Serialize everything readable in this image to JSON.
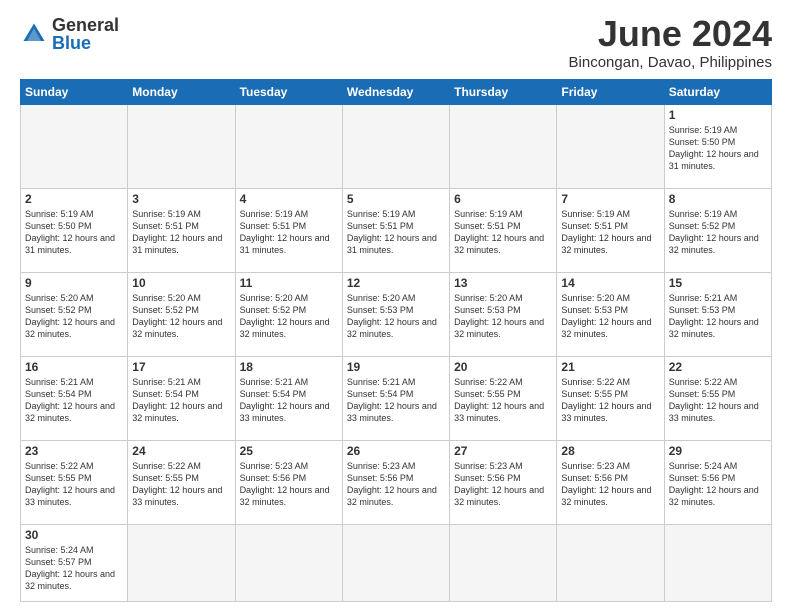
{
  "logo": {
    "general": "General",
    "blue": "Blue"
  },
  "header": {
    "title": "June 2024",
    "subtitle": "Bincongan, Davao, Philippines"
  },
  "days_of_week": [
    "Sunday",
    "Monday",
    "Tuesday",
    "Wednesday",
    "Thursday",
    "Friday",
    "Saturday"
  ],
  "weeks": [
    [
      {
        "day": "",
        "info": "",
        "empty": true
      },
      {
        "day": "",
        "info": "",
        "empty": true
      },
      {
        "day": "",
        "info": "",
        "empty": true
      },
      {
        "day": "",
        "info": "",
        "empty": true
      },
      {
        "day": "",
        "info": "",
        "empty": true
      },
      {
        "day": "",
        "info": "",
        "empty": true
      },
      {
        "day": "1",
        "info": "Sunrise: 5:19 AM\nSunset: 5:50 PM\nDaylight: 12 hours\nand 31 minutes."
      }
    ],
    [
      {
        "day": "2",
        "info": "Sunrise: 5:19 AM\nSunset: 5:50 PM\nDaylight: 12 hours\nand 31 minutes."
      },
      {
        "day": "3",
        "info": "Sunrise: 5:19 AM\nSunset: 5:51 PM\nDaylight: 12 hours\nand 31 minutes."
      },
      {
        "day": "4",
        "info": "Sunrise: 5:19 AM\nSunset: 5:51 PM\nDaylight: 12 hours\nand 31 minutes."
      },
      {
        "day": "5",
        "info": "Sunrise: 5:19 AM\nSunset: 5:51 PM\nDaylight: 12 hours\nand 31 minutes."
      },
      {
        "day": "6",
        "info": "Sunrise: 5:19 AM\nSunset: 5:51 PM\nDaylight: 12 hours\nand 32 minutes."
      },
      {
        "day": "7",
        "info": "Sunrise: 5:19 AM\nSunset: 5:51 PM\nDaylight: 12 hours\nand 32 minutes."
      },
      {
        "day": "8",
        "info": "Sunrise: 5:19 AM\nSunset: 5:52 PM\nDaylight: 12 hours\nand 32 minutes."
      }
    ],
    [
      {
        "day": "9",
        "info": "Sunrise: 5:20 AM\nSunset: 5:52 PM\nDaylight: 12 hours\nand 32 minutes."
      },
      {
        "day": "10",
        "info": "Sunrise: 5:20 AM\nSunset: 5:52 PM\nDaylight: 12 hours\nand 32 minutes."
      },
      {
        "day": "11",
        "info": "Sunrise: 5:20 AM\nSunset: 5:52 PM\nDaylight: 12 hours\nand 32 minutes."
      },
      {
        "day": "12",
        "info": "Sunrise: 5:20 AM\nSunset: 5:53 PM\nDaylight: 12 hours\nand 32 minutes."
      },
      {
        "day": "13",
        "info": "Sunrise: 5:20 AM\nSunset: 5:53 PM\nDaylight: 12 hours\nand 32 minutes."
      },
      {
        "day": "14",
        "info": "Sunrise: 5:20 AM\nSunset: 5:53 PM\nDaylight: 12 hours\nand 32 minutes."
      },
      {
        "day": "15",
        "info": "Sunrise: 5:21 AM\nSunset: 5:53 PM\nDaylight: 12 hours\nand 32 minutes."
      }
    ],
    [
      {
        "day": "16",
        "info": "Sunrise: 5:21 AM\nSunset: 5:54 PM\nDaylight: 12 hours\nand 32 minutes."
      },
      {
        "day": "17",
        "info": "Sunrise: 5:21 AM\nSunset: 5:54 PM\nDaylight: 12 hours\nand 32 minutes."
      },
      {
        "day": "18",
        "info": "Sunrise: 5:21 AM\nSunset: 5:54 PM\nDaylight: 12 hours\nand 33 minutes."
      },
      {
        "day": "19",
        "info": "Sunrise: 5:21 AM\nSunset: 5:54 PM\nDaylight: 12 hours\nand 33 minutes."
      },
      {
        "day": "20",
        "info": "Sunrise: 5:22 AM\nSunset: 5:55 PM\nDaylight: 12 hours\nand 33 minutes."
      },
      {
        "day": "21",
        "info": "Sunrise: 5:22 AM\nSunset: 5:55 PM\nDaylight: 12 hours\nand 33 minutes."
      },
      {
        "day": "22",
        "info": "Sunrise: 5:22 AM\nSunset: 5:55 PM\nDaylight: 12 hours\nand 33 minutes."
      }
    ],
    [
      {
        "day": "23",
        "info": "Sunrise: 5:22 AM\nSunset: 5:55 PM\nDaylight: 12 hours\nand 33 minutes."
      },
      {
        "day": "24",
        "info": "Sunrise: 5:22 AM\nSunset: 5:55 PM\nDaylight: 12 hours\nand 33 minutes."
      },
      {
        "day": "25",
        "info": "Sunrise: 5:23 AM\nSunset: 5:56 PM\nDaylight: 12 hours\nand 32 minutes."
      },
      {
        "day": "26",
        "info": "Sunrise: 5:23 AM\nSunset: 5:56 PM\nDaylight: 12 hours\nand 32 minutes."
      },
      {
        "day": "27",
        "info": "Sunrise: 5:23 AM\nSunset: 5:56 PM\nDaylight: 12 hours\nand 32 minutes."
      },
      {
        "day": "28",
        "info": "Sunrise: 5:23 AM\nSunset: 5:56 PM\nDaylight: 12 hours\nand 32 minutes."
      },
      {
        "day": "29",
        "info": "Sunrise: 5:24 AM\nSunset: 5:56 PM\nDaylight: 12 hours\nand 32 minutes."
      }
    ],
    [
      {
        "day": "30",
        "info": "Sunrise: 5:24 AM\nSunset: 5:57 PM\nDaylight: 12 hours\nand 32 minutes."
      },
      {
        "day": "",
        "info": "",
        "empty": true
      },
      {
        "day": "",
        "info": "",
        "empty": true
      },
      {
        "day": "",
        "info": "",
        "empty": true
      },
      {
        "day": "",
        "info": "",
        "empty": true
      },
      {
        "day": "",
        "info": "",
        "empty": true
      },
      {
        "day": "",
        "info": "",
        "empty": true
      }
    ]
  ],
  "accent_color": "#1a6db5"
}
